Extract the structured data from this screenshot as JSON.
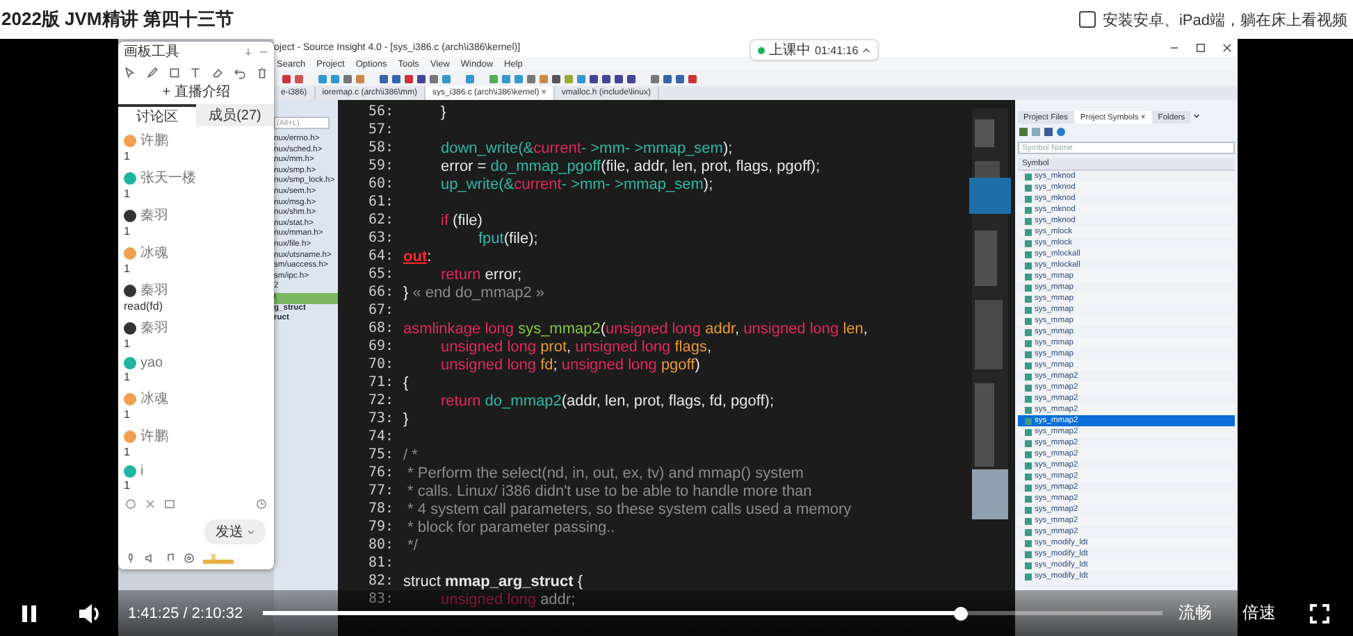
{
  "header": {
    "title": "2022版 JVM精讲 第四十三节",
    "app_promo": {
      "label": "安装安卓、iPad端，躺在床上看视频",
      "checked": false
    }
  },
  "recording": {
    "status": "上课中",
    "time": "01:41:16"
  },
  "editor": {
    "title": "oject - Source Insight 4.0 - [sys_i386.c (arch\\i386\\kernel)]",
    "menu": [
      "Search",
      "Project",
      "Options",
      "Tools",
      "View",
      "Window",
      "Help"
    ],
    "tabs": [
      {
        "label": "e-i386)",
        "selected": false
      },
      {
        "label": "ioremap.c (arch\\i386\\mm)",
        "selected": false
      },
      {
        "label": "sys_i386.c (arch\\i386\\kernel)",
        "selected": true,
        "close": "×"
      },
      {
        "label": "vmalloc.h (include\\linux)",
        "selected": false
      }
    ],
    "symbol_field": {
      "placeholder": "(Alt+L)"
    },
    "file_symbols": [
      {
        "label": "nux/errno.h>",
        "kind": "include",
        "selected": false
      },
      {
        "label": "nux/sched.h>",
        "kind": "include",
        "selected": false
      },
      {
        "label": "nux/mm.h>",
        "kind": "include",
        "selected": false
      },
      {
        "label": "nux/smp.h>",
        "kind": "include",
        "selected": false
      },
      {
        "label": "nux/smp_lock.h>",
        "kind": "include",
        "selected": false
      },
      {
        "label": "nux/sem.h>",
        "kind": "include",
        "selected": false
      },
      {
        "label": "nux/msg.h>",
        "kind": "include",
        "selected": false
      },
      {
        "label": "nux/shm.h>",
        "kind": "include",
        "selected": false
      },
      {
        "label": "nux/stat.h>",
        "kind": "include",
        "selected": false
      },
      {
        "label": "nux/mman.h>",
        "kind": "include",
        "selected": false
      },
      {
        "label": "nux/file.h>",
        "kind": "include",
        "selected": false
      },
      {
        "label": "nux/utsname.h>",
        "kind": "include",
        "selected": false
      },
      {
        "label": "sm/uaccess.h>",
        "kind": "include",
        "selected": false
      },
      {
        "label": "sm/ipc.h>",
        "kind": "include",
        "selected": false
      },
      {
        "label": "2",
        "kind": "symbol",
        "selected": false
      },
      {
        "label": "i",
        "kind": "symbol",
        "selected": true
      },
      {
        "label": "g_struct",
        "kind": "struct",
        "selected": false
      },
      {
        "label": "ruct",
        "kind": "struct",
        "selected": false
      }
    ],
    "code_lines": [
      {
        "number": "56:",
        "tokens": [
          {
            "kind": "plain",
            "text": "\t}"
          }
        ]
      },
      {
        "number": "57:"
      },
      {
        "number": "58:",
        "tokens": [
          {
            "kind": "fn",
            "text": "\tdown_write(&"
          },
          {
            "kind": "var",
            "text": "current"
          },
          {
            "kind": "fn",
            "text": "- >mm- >mmap_sem"
          },
          {
            "kind": "plain",
            "text": ");"
          }
        ]
      },
      {
        "number": "59:",
        "tokens": [
          {
            "kind": "plain",
            "text": "\terror = "
          },
          {
            "kind": "fn",
            "text": "do_mmap_pgoff"
          },
          {
            "kind": "plain",
            "text": "(file, addr, len, prot, flags, pgoff);"
          }
        ]
      },
      {
        "number": "60:",
        "tokens": [
          {
            "kind": "fn",
            "text": "\tup_write(&"
          },
          {
            "kind": "var",
            "text": "current"
          },
          {
            "kind": "fn",
            "text": "- >mm- >mmap_sem"
          },
          {
            "kind": "plain",
            "text": ");"
          }
        ]
      },
      {
        "number": "61:"
      },
      {
        "number": "62:",
        "tokens": [
          {
            "kind": "kw",
            "text": "\tif"
          },
          {
            "kind": "plain",
            "text": " (file)"
          }
        ]
      },
      {
        "number": "63:",
        "tokens": [
          {
            "kind": "fn",
            "text": "\t\tfput"
          },
          {
            "kind": "plain",
            "text": "(file);"
          }
        ]
      },
      {
        "number": "64:",
        "tokens": [
          {
            "kind": "label",
            "text": "out"
          },
          {
            "kind": "plain",
            "text": ":"
          }
        ]
      },
      {
        "number": "65:",
        "tokens": [
          {
            "kind": "kw",
            "text": "\treturn"
          },
          {
            "kind": "plain",
            "text": " error;"
          }
        ]
      },
      {
        "number": "66:",
        "tokens": [
          {
            "kind": "plain",
            "text": "}"
          },
          {
            "kind": "comment",
            "text": " « end do_mmap2 »"
          }
        ]
      },
      {
        "number": "67:"
      },
      {
        "number": "68:",
        "tokens": [
          {
            "kind": "kw",
            "text": "asmlinkage long "
          },
          {
            "kind": "fn2",
            "text": "sys_mmap2"
          },
          {
            "kind": "plain",
            "text": "("
          },
          {
            "kind": "kw",
            "text": "unsigned long "
          },
          {
            "kind": "param",
            "text": "addr"
          },
          {
            "kind": "plain",
            "text": ", "
          },
          {
            "kind": "kw",
            "text": "unsigned long "
          },
          {
            "kind": "param",
            "text": "len"
          },
          {
            "kind": "plain",
            "text": ","
          }
        ]
      },
      {
        "number": "69:",
        "tokens": [
          {
            "kind": "kw",
            "text": "\tunsigned long "
          },
          {
            "kind": "param",
            "text": "prot"
          },
          {
            "kind": "plain",
            "text": ", "
          },
          {
            "kind": "kw",
            "text": "unsigned long "
          },
          {
            "kind": "param",
            "text": "flags"
          },
          {
            "kind": "plain",
            "text": ","
          }
        ]
      },
      {
        "number": "70:",
        "tokens": [
          {
            "kind": "kw",
            "text": "\tunsigned long "
          },
          {
            "kind": "param",
            "text": "fd"
          },
          {
            "kind": "plain",
            "text": "; "
          },
          {
            "kind": "kw",
            "text": "unsigned long "
          },
          {
            "kind": "param",
            "text": "pgoff"
          },
          {
            "kind": "plain",
            "text": ")"
          }
        ]
      },
      {
        "number": "71:",
        "tokens": [
          {
            "kind": "plain",
            "text": "{"
          }
        ]
      },
      {
        "number": "72:",
        "tokens": [
          {
            "kind": "kw",
            "text": "\treturn "
          },
          {
            "kind": "fn",
            "text": "do_mmap2"
          },
          {
            "kind": "plain",
            "text": "(addr, len, prot, flags, fd, pgoff);"
          }
        ]
      },
      {
        "number": "73:",
        "tokens": [
          {
            "kind": "plain",
            "text": "}"
          }
        ]
      },
      {
        "number": "74:"
      },
      {
        "number": "75:",
        "tokens": [
          {
            "kind": "comment",
            "text": "/ *"
          }
        ]
      },
      {
        "number": "76:",
        "tokens": [
          {
            "kind": "comment",
            "text": " * Perform the select(nd, in, out, ex, tv) and mmap() system"
          }
        ]
      },
      {
        "number": "77:",
        "tokens": [
          {
            "kind": "comment",
            "text": " * calls. Linux/ i386 didn't use to be able to handle more than"
          }
        ]
      },
      {
        "number": "78:",
        "tokens": [
          {
            "kind": "comment",
            "text": " * 4 system call parameters, so these system calls used a memory"
          }
        ]
      },
      {
        "number": "79:",
        "tokens": [
          {
            "kind": "comment",
            "text": " * block for parameter passing.."
          }
        ]
      },
      {
        "number": "80:",
        "tokens": [
          {
            "kind": "comment",
            "text": " */"
          }
        ]
      },
      {
        "number": "81:"
      },
      {
        "number": "82:",
        "tokens": [
          {
            "kind": "plain",
            "text": "struct "
          },
          {
            "kind": "bold",
            "text": "mmap_arg_struct"
          },
          {
            "kind": "plain",
            "text": " {"
          }
        ]
      },
      {
        "number": "83:",
        "tokens": [
          {
            "kind": "kw",
            "text": "\tunsigned long "
          },
          {
            "kind": "plain",
            "text": "addr;"
          }
        ]
      }
    ],
    "symbol_panel": {
      "tabs": [
        {
          "label": "Project Files",
          "selected": false
        },
        {
          "label": "Project Symbols",
          "selected": true,
          "close": "×"
        },
        {
          "label": "Folders",
          "selected": false
        }
      ],
      "search": {
        "placeholder": "Symbol Name"
      },
      "column": "Symbol",
      "symbols": [
        {
          "label": "sys_mknod",
          "selected": false
        },
        {
          "label": "sys_mknod",
          "selected": false
        },
        {
          "label": "sys_mknod",
          "selected": false
        },
        {
          "label": "sys_mknod",
          "selected": false
        },
        {
          "label": "sys_mknod",
          "selected": false
        },
        {
          "label": "sys_mlock",
          "selected": false
        },
        {
          "label": "sys_mlock",
          "selected": false
        },
        {
          "label": "sys_mlockall",
          "selected": false
        },
        {
          "label": "sys_mlockall",
          "selected": false
        },
        {
          "label": "sys_mmap",
          "selected": false
        },
        {
          "label": "sys_mmap",
          "selected": false
        },
        {
          "label": "sys_mmap",
          "selected": false
        },
        {
          "label": "sys_mmap",
          "selected": false
        },
        {
          "label": "sys_mmap",
          "selected": false
        },
        {
          "label": "sys_mmap",
          "selected": false
        },
        {
          "label": "sys_mmap",
          "selected": false
        },
        {
          "label": "sys_mmap",
          "selected": false
        },
        {
          "label": "sys_mmap",
          "selected": false
        },
        {
          "label": "sys_mmap2",
          "selected": false
        },
        {
          "label": "sys_mmap2",
          "selected": false
        },
        {
          "label": "sys_mmap2",
          "selected": false
        },
        {
          "label": "sys_mmap2",
          "selected": false
        },
        {
          "label": "sys_mmap2",
          "selected": true
        },
        {
          "label": "sys_mmap2",
          "selected": false
        },
        {
          "label": "sys_mmap2",
          "selected": false
        },
        {
          "label": "sys_mmap2",
          "selected": false
        },
        {
          "label": "sys_mmap2",
          "selected": false
        },
        {
          "label": "sys_mmap2",
          "selected": false
        },
        {
          "label": "sys_mmap2",
          "selected": false
        },
        {
          "label": "sys_mmap2",
          "selected": false
        },
        {
          "label": "sys_mmap2",
          "selected": false
        },
        {
          "label": "sys_mmap2",
          "selected": false
        },
        {
          "label": "sys_mmap2",
          "selected": false
        },
        {
          "label": "sys_modify_ldt",
          "selected": false
        },
        {
          "label": "sys_modify_ldt",
          "selected": false
        },
        {
          "label": "sys_modify_ldt",
          "selected": false
        },
        {
          "label": "sys_modify_ldt",
          "selected": false
        }
      ]
    }
  },
  "chat": {
    "title": "画板工具",
    "intro": "+ 直播介绍",
    "tabs": [
      {
        "label": "讨论区",
        "selected": true
      },
      {
        "label": "成员(27)",
        "selected": false
      }
    ],
    "messages": [
      {
        "name": "许鹏",
        "text": "1",
        "color": "#f0a050"
      },
      {
        "name": "张天一楼",
        "text": "1",
        "color": "#1fb5a0"
      },
      {
        "name": "秦羽",
        "text": "1",
        "color": "#333333"
      },
      {
        "name": "冰魂",
        "text": "1",
        "color": "#f0a050"
      },
      {
        "name": "秦羽",
        "text": "read(fd)",
        "color": "#333333"
      },
      {
        "name": "秦羽",
        "text": "1",
        "color": "#333333"
      },
      {
        "name": "yao",
        "text": "1",
        "color": "#1fb5a0"
      },
      {
        "name": "冰魂",
        "text": "1",
        "color": "#f0a050"
      },
      {
        "name": "许鹏",
        "text": "1",
        "color": "#f0a050"
      },
      {
        "name": "i",
        "text": "1",
        "color": "#1fb5a0"
      }
    ],
    "send": "发送"
  },
  "player": {
    "playing": true,
    "current": "1:41:25",
    "separator": "/",
    "total": "2:10:32",
    "level": 0.777,
    "quality": "流畅",
    "speed": "倍速"
  }
}
